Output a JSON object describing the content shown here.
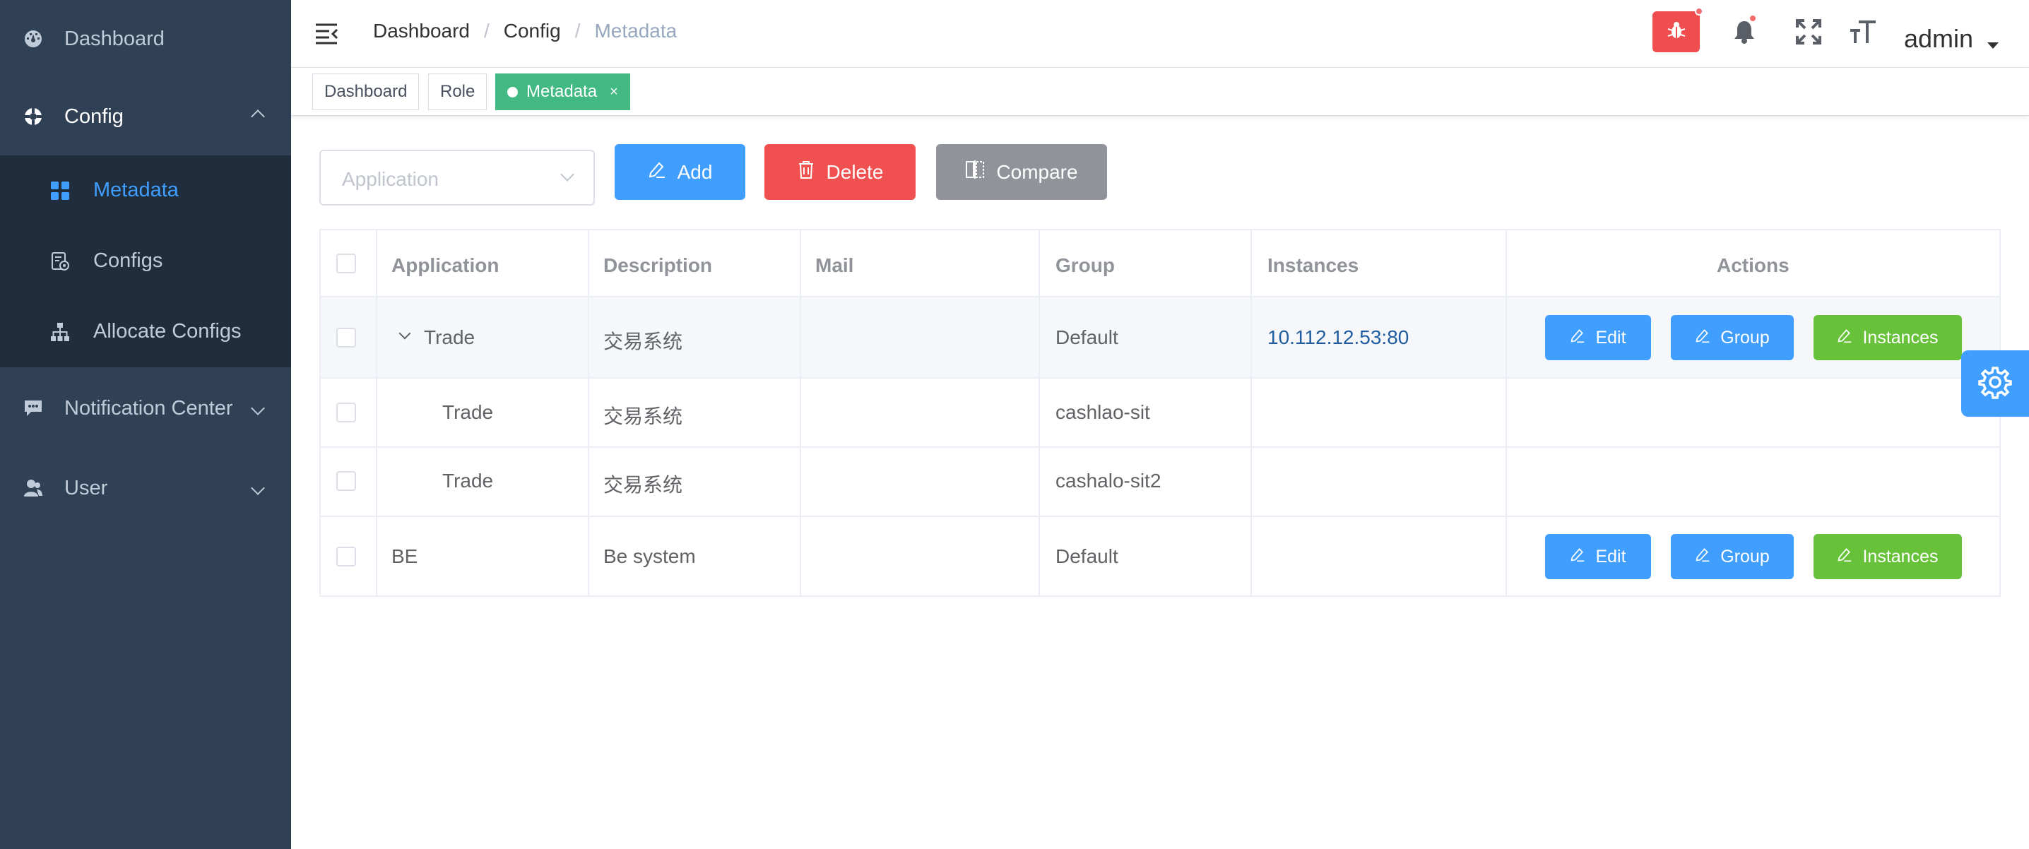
{
  "sidebar": {
    "items": [
      {
        "label": "Dashboard",
        "icon": "dashboard-icon"
      },
      {
        "label": "Config",
        "icon": "config-icon",
        "expanded": true,
        "children": [
          {
            "label": "Metadata",
            "icon": "metadata-icon",
            "active": true
          },
          {
            "label": "Configs",
            "icon": "configs-icon"
          },
          {
            "label": "Allocate Configs",
            "icon": "allocate-icon"
          }
        ]
      },
      {
        "label": "Notification Center",
        "icon": "notification-icon"
      },
      {
        "label": "User",
        "icon": "user-icon"
      }
    ]
  },
  "navbar": {
    "breadcrumb": [
      "Dashboard",
      "Config",
      "Metadata"
    ],
    "breadcrumb_separator": "/",
    "user": "admin"
  },
  "tags": [
    {
      "label": "Dashboard",
      "active": false
    },
    {
      "label": "Role",
      "active": false
    },
    {
      "label": "Metadata",
      "active": true,
      "close": "×"
    }
  ],
  "toolbar": {
    "application_placeholder": "Application",
    "add_label": "Add",
    "delete_label": "Delete",
    "compare_label": "Compare"
  },
  "table": {
    "columns": [
      "Application",
      "Description",
      "Mail",
      "Group",
      "Instances",
      "Actions"
    ],
    "rows": [
      {
        "application": "Trade",
        "description": "交易系统",
        "mail": "",
        "group": "Default",
        "instances": "10.112.12.53:80",
        "expandable": true,
        "actions": [
          "Edit",
          "Group",
          "Instances"
        ]
      },
      {
        "application": "Trade",
        "description": "交易系统",
        "mail": "",
        "group": "cashlao-sit",
        "instances": "",
        "child": true
      },
      {
        "application": "Trade",
        "description": "交易系统",
        "mail": "",
        "group": "cashalo-sit2",
        "instances": "",
        "child": true
      },
      {
        "application": "BE",
        "description": "Be system",
        "mail": "",
        "group": "Default",
        "instances": "",
        "actions": [
          "Edit",
          "Group",
          "Instances"
        ]
      }
    ]
  },
  "colors": {
    "sidebar_bg": "#304156",
    "submenu_bg": "#1f2d3d",
    "primary": "#409eff",
    "danger": "#f0504f",
    "info": "#909399",
    "success": "#67c23a",
    "tag_active": "#42b983"
  }
}
